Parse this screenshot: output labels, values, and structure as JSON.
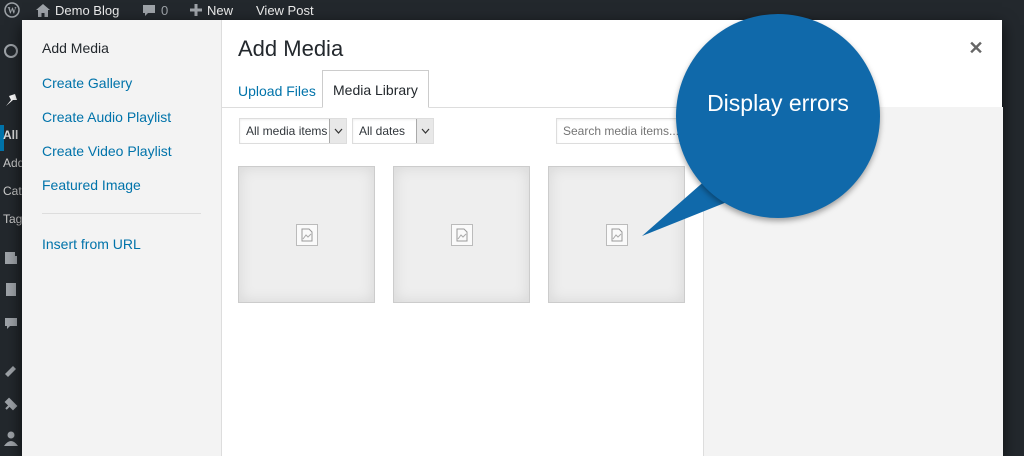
{
  "adminbar": {
    "site_name": "Demo Blog",
    "comments_count": "0",
    "new_label": "New",
    "view_post_label": "View Post"
  },
  "adminmenu": {
    "labels": [
      "All",
      "Add",
      "Cat",
      "Tag"
    ]
  },
  "modal": {
    "title": "Add Media",
    "close_icon": "close-icon",
    "menu": {
      "items": [
        "Add Media",
        "Create Gallery",
        "Create Audio Playlist",
        "Create Video Playlist",
        "Featured Image"
      ],
      "insert_from_url": "Insert from URL"
    },
    "tabs": {
      "upload": "Upload Files",
      "library": "Media Library"
    },
    "toolbar": {
      "type_filter": "All media items",
      "date_filter": "All dates",
      "search_placeholder": "Search media items..."
    },
    "attachments_count": 3
  },
  "callout": {
    "text": "Display errors",
    "color": "#1069aa"
  },
  "colors": {
    "link": "#0073aa",
    "admin_dark": "#23282d"
  }
}
